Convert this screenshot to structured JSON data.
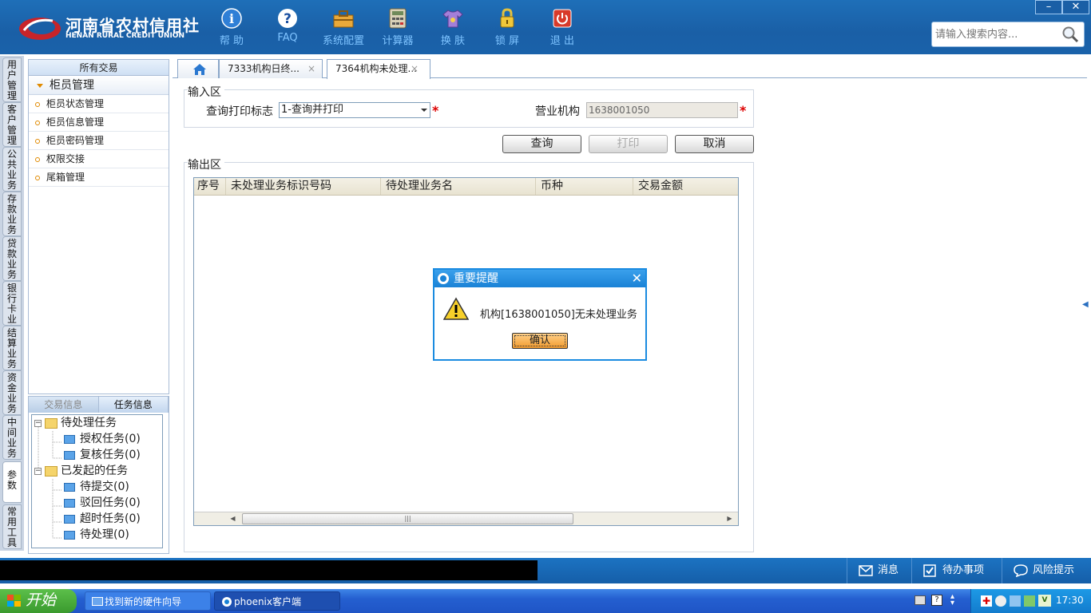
{
  "header": {
    "logo_cn": "河南省农村信用社",
    "logo_en": "HENAN RURAL CREDIT UNION",
    "toolbar": [
      {
        "label": "帮 助",
        "icon": "info-icon"
      },
      {
        "label": "FAQ",
        "icon": "question-icon"
      },
      {
        "label": "系统配置",
        "icon": "toolbox-icon"
      },
      {
        "label": "计算器",
        "icon": "calculator-icon"
      },
      {
        "label": "换 肤",
        "icon": "shirt-icon"
      },
      {
        "label": "锁 屏",
        "icon": "lock-icon"
      },
      {
        "label": "退 出",
        "icon": "power-icon"
      }
    ],
    "search_placeholder": "请输入搜索内容...",
    "minimize": "–",
    "close": "✕"
  },
  "vtabs": [
    "用户管理",
    "客户管理",
    "公共业务",
    "存款业务",
    "贷款业务",
    "银行卡业务",
    "结算业务",
    "资金业务",
    "中间业务",
    "参数",
    "常用工具"
  ],
  "menu": {
    "header": "所有交易",
    "group": "柜员管理",
    "items": [
      "柜员状态管理",
      "柜员信息管理",
      "柜员密码管理",
      "权限交接",
      "尾箱管理"
    ]
  },
  "task": {
    "tabs": [
      "交易信息",
      "任务信息"
    ],
    "tree": {
      "pending": "待处理任务",
      "pending_items": [
        "授权任务(0)",
        "复核任务(0)"
      ],
      "initiated": "已发起的任务",
      "initiated_items": [
        "待提交(0)",
        "驳回任务(0)",
        "超时任务(0)",
        "待处理(0)"
      ]
    }
  },
  "tabs": {
    "home": "home-icon",
    "items": [
      "7333机构日终...",
      "7364机构未处理..."
    ],
    "close": "×"
  },
  "form": {
    "input_title": "输入区",
    "query_flag_label": "查询打印标志",
    "query_flag_value": "1-查询并打印",
    "org_label": "营业机构",
    "org_value": "1638001050",
    "required": "*",
    "query_btn": "查询",
    "print_btn": "打印",
    "cancel_btn": "取消",
    "output_title": "输出区"
  },
  "grid": {
    "columns": [
      "序号",
      "未处理业务标识号码",
      "待处理业务名",
      "币种",
      "交易金额"
    ],
    "rows": []
  },
  "dialog": {
    "title": "重要提醒",
    "message": "机构[1638001050]无未处理业务",
    "ok": "确认",
    "close": "✕"
  },
  "statusbar": {
    "items": [
      "消息",
      "待办事项",
      "风险提示"
    ]
  },
  "taskbar": {
    "start": "开始",
    "tasks": [
      "找到新的硬件向导",
      "phoenix客户端"
    ],
    "time": "17:30"
  }
}
